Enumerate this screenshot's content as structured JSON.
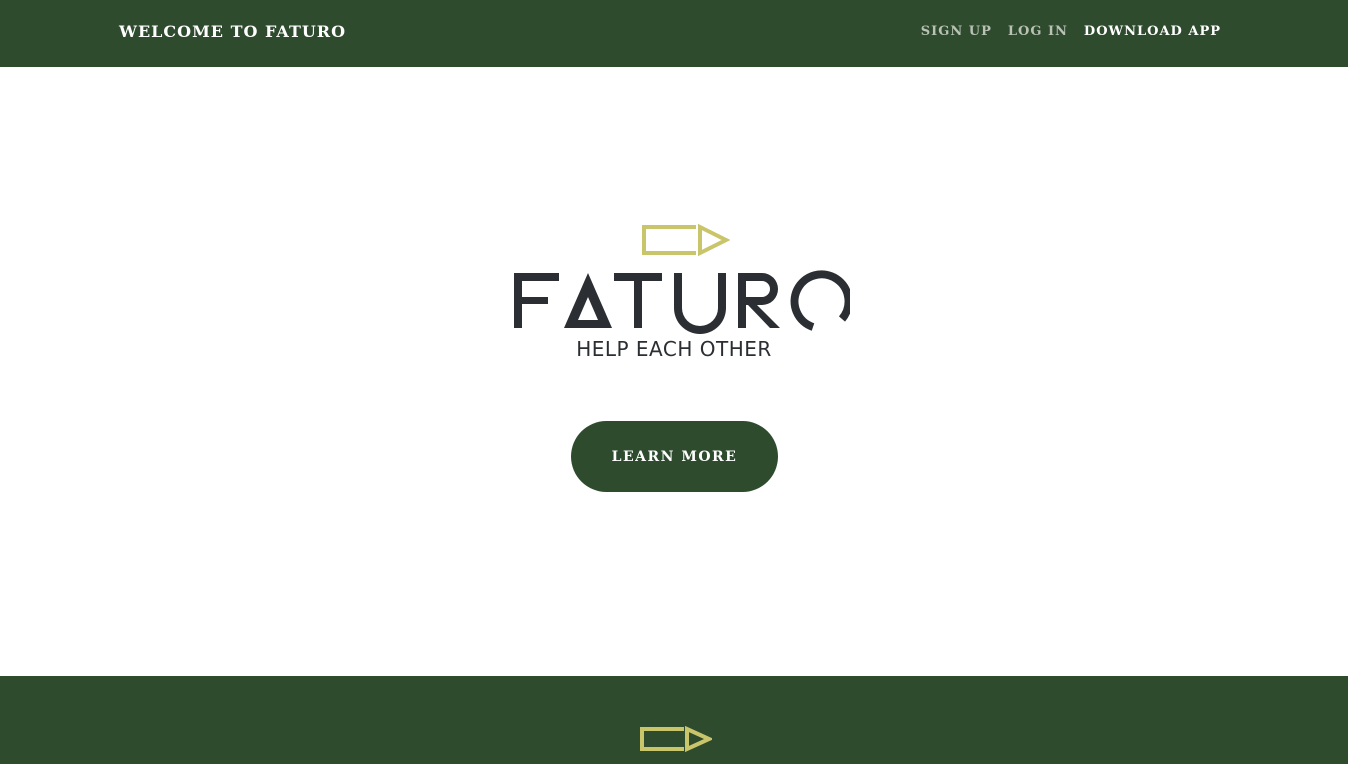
{
  "header": {
    "brand": "WELCOME TO FATURO",
    "nav": {
      "sign_up": "SIGN UP",
      "log_in": "LOG IN",
      "download_app": "DOWNLOAD APP"
    }
  },
  "hero": {
    "logo_text": "FATURO",
    "tagline": "HELP EACH OTHER",
    "cta_label": "LEARN MORE"
  },
  "colors": {
    "primary_green": "#2e4b2e",
    "logo_yellow": "#c9c56a",
    "logo_dark": "#2b2f33",
    "nav_muted": "#b9c2b5",
    "white": "#ffffff"
  },
  "icons": {
    "logo_mark": "pencil-arrow-icon",
    "footer_mark": "pencil-arrow-icon"
  }
}
